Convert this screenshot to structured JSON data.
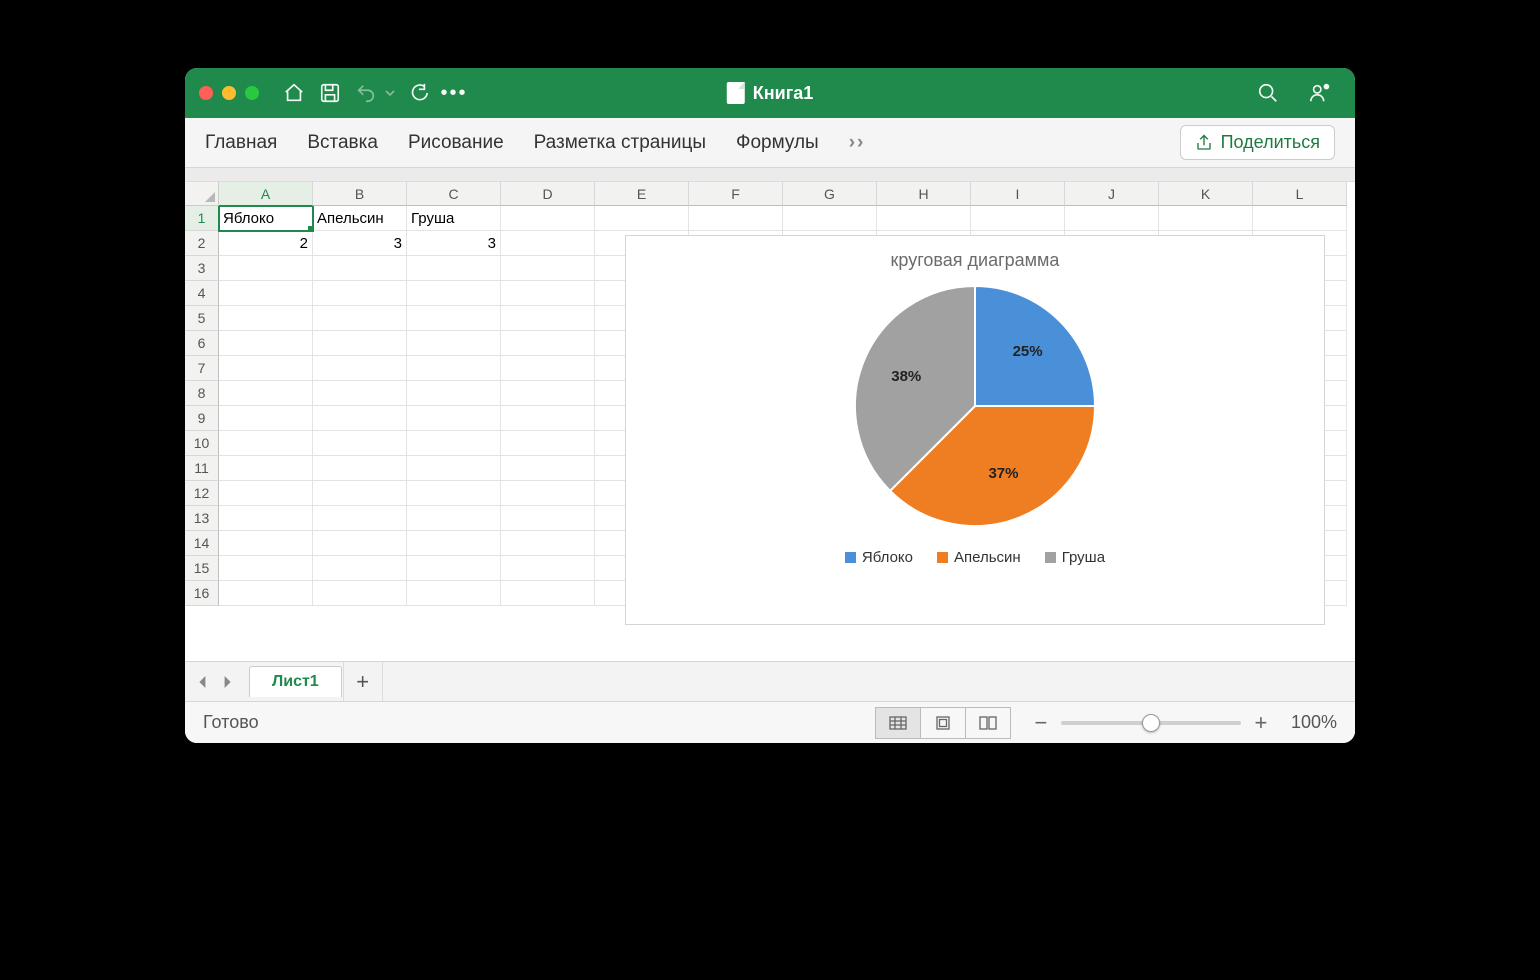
{
  "title": "Книга1",
  "ribbon": {
    "tabs": [
      "Главная",
      "Вставка",
      "Рисование",
      "Разметка страницы",
      "Формулы"
    ],
    "more": "››",
    "share": "Поделиться"
  },
  "columns": [
    "A",
    "B",
    "C",
    "D",
    "E",
    "F",
    "G",
    "H",
    "I",
    "J",
    "K",
    "L"
  ],
  "rows_count": 16,
  "selected_cell": "A1",
  "cells": {
    "A1": "Яблоко",
    "B1": "Апельсин",
    "C1": "Груша",
    "A2": "2",
    "B2": "3",
    "C2": "3"
  },
  "chart_data": {
    "type": "pie",
    "title": "круговая диаграмма",
    "series": [
      {
        "name": "Яблоко",
        "value": 2,
        "percent": 25,
        "color": "#4a90d9"
      },
      {
        "name": "Апельсин",
        "value": 3,
        "percent": 37,
        "color": "#ef7d22"
      },
      {
        "name": "Груша",
        "value": 3,
        "percent": 38,
        "color": "#a1a1a1"
      }
    ]
  },
  "sheet": {
    "active": "Лист1"
  },
  "status": {
    "ready": "Готово",
    "zoom": "100%"
  }
}
